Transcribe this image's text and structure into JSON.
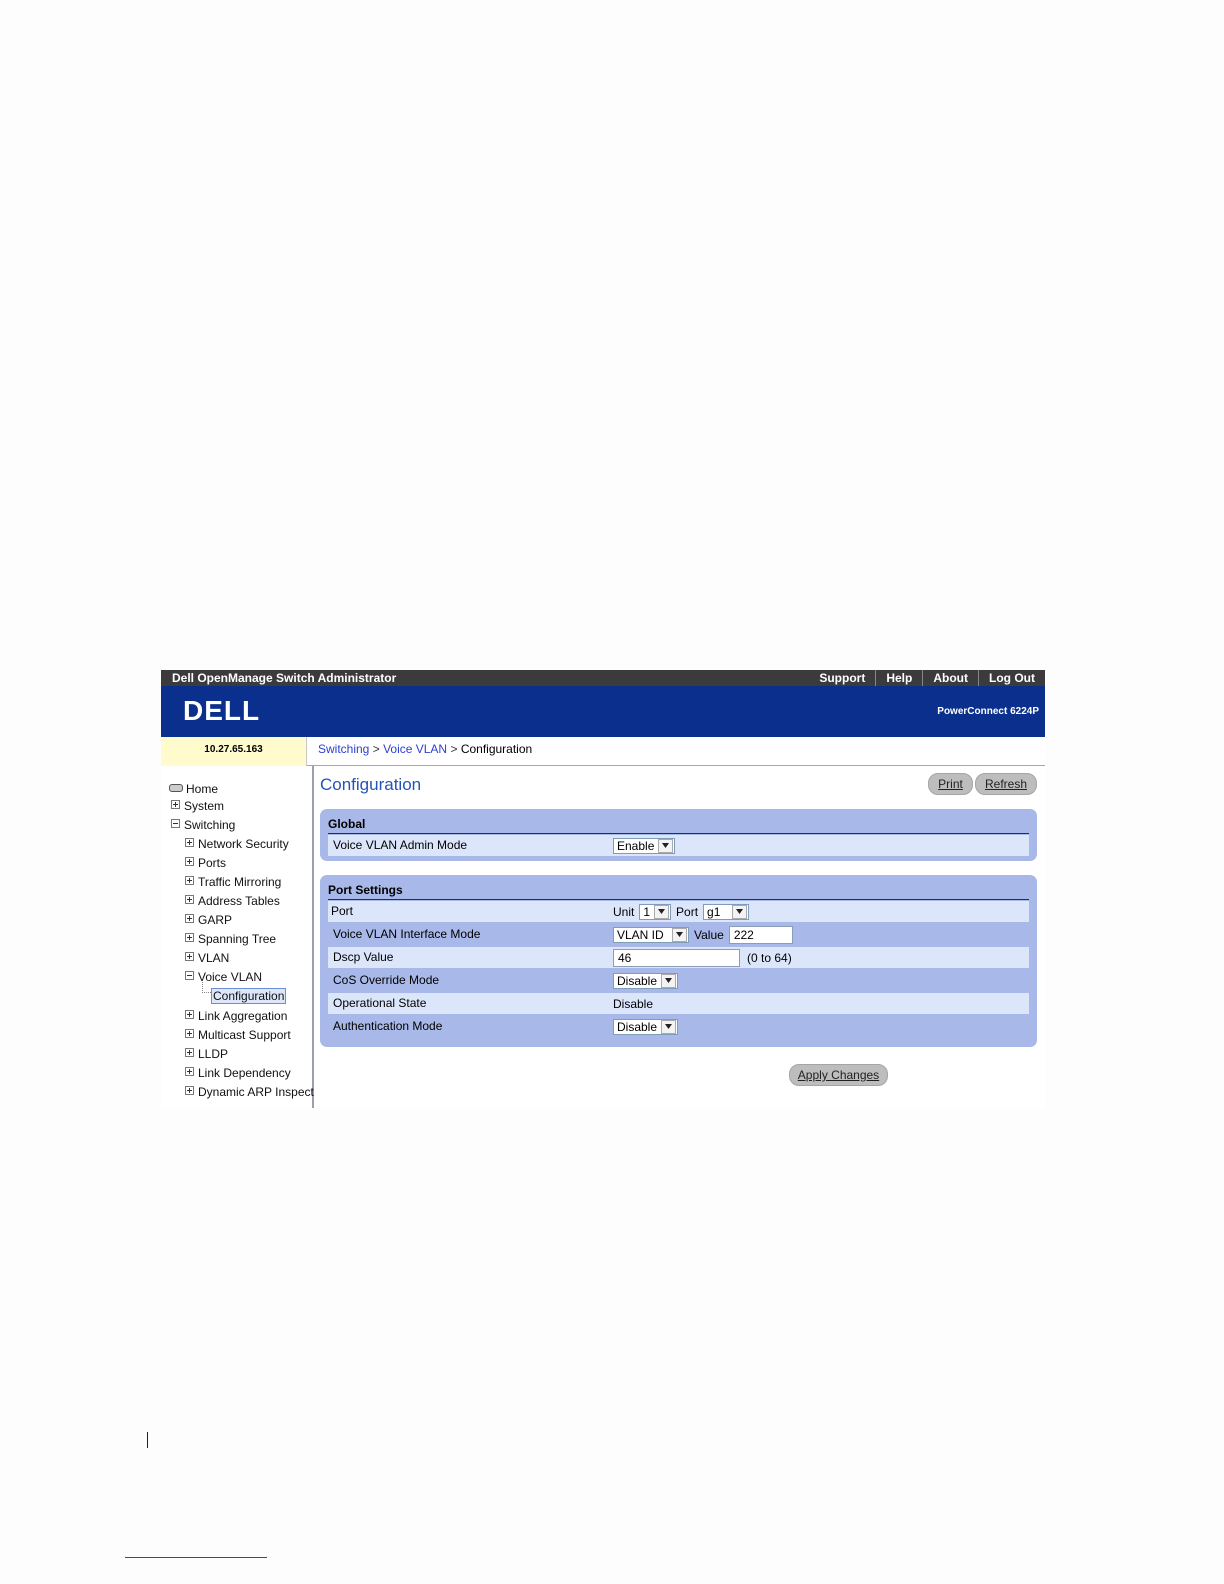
{
  "app": {
    "title": "Dell OpenManage Switch Administrator",
    "top_links": [
      "Support",
      "Help",
      "About",
      "Log Out"
    ],
    "logo_text": "DELL",
    "model": "PowerConnect 6224P",
    "ip_address": "10.27.65.163"
  },
  "breadcrumb": {
    "items": [
      "Switching",
      "Voice VLAN",
      "Configuration"
    ],
    "separator": ">"
  },
  "nav": {
    "items": [
      {
        "label": "Home",
        "state": "home"
      },
      {
        "label": "System",
        "state": "collapsed"
      },
      {
        "label": "Switching",
        "state": "expanded"
      },
      {
        "label": "Network Security",
        "state": "collapsed"
      },
      {
        "label": "Ports",
        "state": "collapsed"
      },
      {
        "label": "Traffic Mirroring",
        "state": "collapsed"
      },
      {
        "label": "Address Tables",
        "state": "collapsed"
      },
      {
        "label": "GARP",
        "state": "collapsed"
      },
      {
        "label": "Spanning Tree",
        "state": "collapsed"
      },
      {
        "label": "VLAN",
        "state": "collapsed"
      },
      {
        "label": "Voice VLAN",
        "state": "expanded"
      },
      {
        "label": "Configuration",
        "state": "selected"
      },
      {
        "label": "Link Aggregation",
        "state": "collapsed"
      },
      {
        "label": "Multicast Support",
        "state": "collapsed"
      },
      {
        "label": "LLDP",
        "state": "collapsed"
      },
      {
        "label": "Link Dependency",
        "state": "collapsed"
      },
      {
        "label": "Dynamic ARP Inspecti",
        "state": "collapsed"
      }
    ]
  },
  "page": {
    "title": "Configuration",
    "print_label": "Print",
    "refresh_label": "Refresh",
    "apply_label": "Apply Changes"
  },
  "global": {
    "title": "Global",
    "admin_mode_label": "Voice VLAN Admin Mode",
    "admin_mode_value": "Enable"
  },
  "port_settings": {
    "title": "Port Settings",
    "port_label": "Port",
    "unit_label": "Unit",
    "unit_value": "1",
    "port_sel_label": "Port",
    "port_value": "g1",
    "interface_mode_label": "Voice VLAN Interface Mode",
    "interface_mode_value": "VLAN ID",
    "value_label": "Value",
    "value_value": "222",
    "dscp_label": "Dscp Value",
    "dscp_value": "46",
    "dscp_range": "(0 to 64)",
    "cos_label": "CoS Override Mode",
    "cos_value": "Disable",
    "operational_label": "Operational State",
    "operational_value": "Disable",
    "auth_label": "Authentication Mode",
    "auth_value": "Disable"
  },
  "colors": {
    "banner": "#0a2f8c",
    "topbar": "#3b3b3b",
    "panel": "#a8b8e8",
    "row_light": "#dce6fb",
    "link": "#2b3fd0",
    "ip_background": "#fffbcc"
  }
}
